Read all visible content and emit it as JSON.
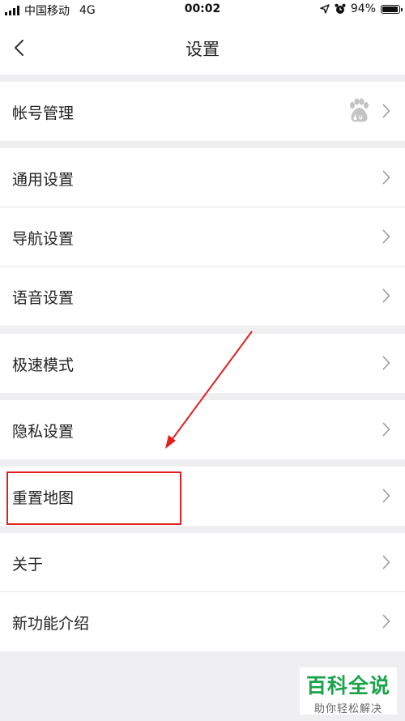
{
  "status_bar": {
    "carrier": "中国移动",
    "network": "4G",
    "time": "00:02",
    "battery_percent": "94%",
    "battery_level": 0.94,
    "icons": [
      "signal-icon",
      "location-arrow-icon",
      "alarm-clock-icon",
      "battery-icon"
    ]
  },
  "header": {
    "title": "设置",
    "back_icon": "chevron-left-icon"
  },
  "groups": [
    {
      "items": [
        {
          "id": "account",
          "label": "帐号管理",
          "extra_icon": "baidu-paw-icon"
        }
      ]
    },
    {
      "items": [
        {
          "id": "general",
          "label": "通用设置"
        },
        {
          "id": "navigation",
          "label": "导航设置"
        },
        {
          "id": "voice",
          "label": "语音设置"
        }
      ]
    },
    {
      "items": [
        {
          "id": "speed-mode",
          "label": "极速模式"
        }
      ]
    },
    {
      "items": [
        {
          "id": "privacy",
          "label": "隐私设置"
        }
      ]
    },
    {
      "items": [
        {
          "id": "reset-map",
          "label": "重置地图"
        }
      ]
    },
    {
      "items": [
        {
          "id": "about",
          "label": "关于"
        },
        {
          "id": "new-features",
          "label": "新功能介绍"
        }
      ]
    }
  ],
  "annotation": {
    "highlighted_item": "reset-map",
    "color": "#e02020"
  },
  "watermark": {
    "title": "百科全说",
    "subtitle": "助你轻松解决",
    "color": "#1aa34a"
  },
  "colors": {
    "background": "#efeff1",
    "surface": "#ffffff",
    "text": "#222222",
    "chevron": "#9a9a9a"
  }
}
